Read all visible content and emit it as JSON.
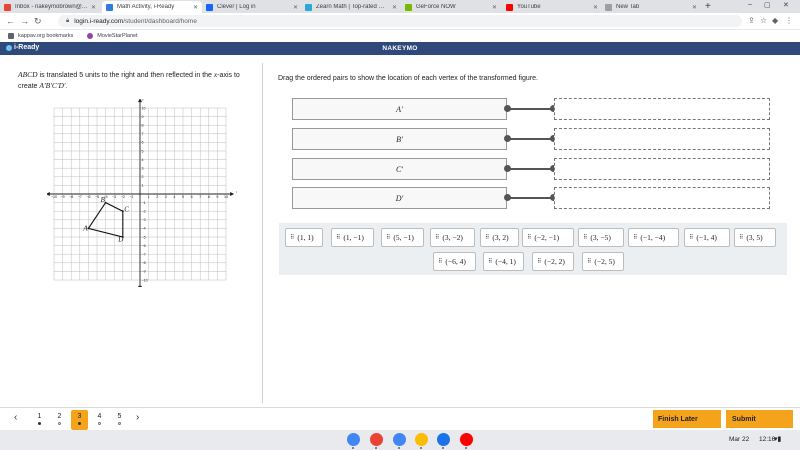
{
  "browser": {
    "tabs": [
      {
        "title": "Inbox - nakeymobrown@kappa...",
        "icon": "gmail-icon",
        "color": "#ea4335"
      },
      {
        "title": "Math Activity, i-Ready",
        "icon": "iready-icon",
        "color": "#2f7de1"
      },
      {
        "title": "Clever | Log in",
        "icon": "clever-icon",
        "color": "#1464ff"
      },
      {
        "title": "Zearn Math | Top-rated Math Le...",
        "icon": "zearn-icon",
        "color": "#2aa9d6"
      },
      {
        "title": "GeForce NOW",
        "icon": "geforce-icon",
        "color": "#76b900"
      },
      {
        "title": "YouTube",
        "icon": "youtube-icon",
        "color": "#ff0000"
      },
      {
        "title": "New Tab",
        "icon": "chrome-icon",
        "color": "#9aa0a6"
      }
    ],
    "url_host": "login.i-ready.com",
    "url_path": "/student/dashboard/home",
    "bookmarks": [
      {
        "label": "kappav.org bookmarks",
        "icon": "folder-icon"
      },
      {
        "label": "MovieStarPlanet",
        "icon": "moviestarplanet-icon"
      }
    ]
  },
  "header": {
    "logo": "i-Ready",
    "student_name": "NAKEYMO"
  },
  "problem": {
    "shape_name": "ABCD",
    "text_part1": " is translated 5 units to the right and then reflected in the ",
    "axis_name": "x",
    "text_part2": "-axis to create ",
    "image_name": "A′B′C′D′",
    "text_end": "."
  },
  "graph": {
    "x_label": "x",
    "y_label": "y",
    "x_ticks": [
      "−10",
      "−9",
      "−8",
      "−7",
      "−6",
      "−5",
      "−4",
      "−3",
      "−2",
      "−1",
      "1",
      "2",
      "3",
      "4",
      "5",
      "6",
      "7",
      "8",
      "9",
      "10"
    ],
    "y_ticks": [
      "10",
      "9",
      "8",
      "7",
      "6",
      "5",
      "4",
      "3",
      "2",
      "1",
      "−1",
      "−2",
      "−3",
      "−4",
      "−5",
      "−6",
      "−7",
      "−8",
      "−9",
      "−10"
    ],
    "vertices": [
      {
        "label": "A",
        "x": -6,
        "y": -4
      },
      {
        "label": "B",
        "x": -4,
        "y": -1
      },
      {
        "label": "C",
        "x": -2,
        "y": -2
      },
      {
        "label": "D",
        "x": -2,
        "y": -5
      }
    ]
  },
  "instructions": "Drag the ordered pairs to show the location of each vertex of the transformed figure.",
  "answer_rows": [
    {
      "vertex": "A′"
    },
    {
      "vertex": "B′"
    },
    {
      "vertex": "C′"
    },
    {
      "vertex": "D′"
    }
  ],
  "choices": [
    "(1, 1)",
    "(1, −1)",
    "(5, −1)",
    "(3, −2)",
    "(3, 2)",
    "(−2, −1)",
    "(3, −5)",
    "(−1, −4)",
    "(−1, 4)",
    "(3, 5)",
    "(−6, 4)",
    "(−4, 1)",
    "(−2, 2)",
    "(−2, 5)"
  ],
  "nav": {
    "questions": [
      {
        "num": "1",
        "state": "answered"
      },
      {
        "num": "2",
        "state": "unanswered"
      },
      {
        "num": "3",
        "state": "current"
      },
      {
        "num": "4",
        "state": "unanswered"
      },
      {
        "num": "5",
        "state": "unanswered"
      }
    ],
    "finish_later": "Finish Later",
    "submit": "Submit"
  },
  "shelf": {
    "apps": [
      {
        "icon": "chrome-icon",
        "color": "#4285f4"
      },
      {
        "icon": "gmail-icon",
        "color": "#ea4335"
      },
      {
        "icon": "docs-icon",
        "color": "#4285f4"
      },
      {
        "icon": "slides-icon",
        "color": "#fbbc04"
      },
      {
        "icon": "files-icon",
        "color": "#1a73e8"
      },
      {
        "icon": "youtube-icon",
        "color": "#ff0000"
      }
    ],
    "date": "Mar 22",
    "time": "12:16"
  },
  "colors": {
    "iready_header": "#2f4a7a",
    "accent_orange": "#f5a31a",
    "tray_background": "#eceff2"
  }
}
